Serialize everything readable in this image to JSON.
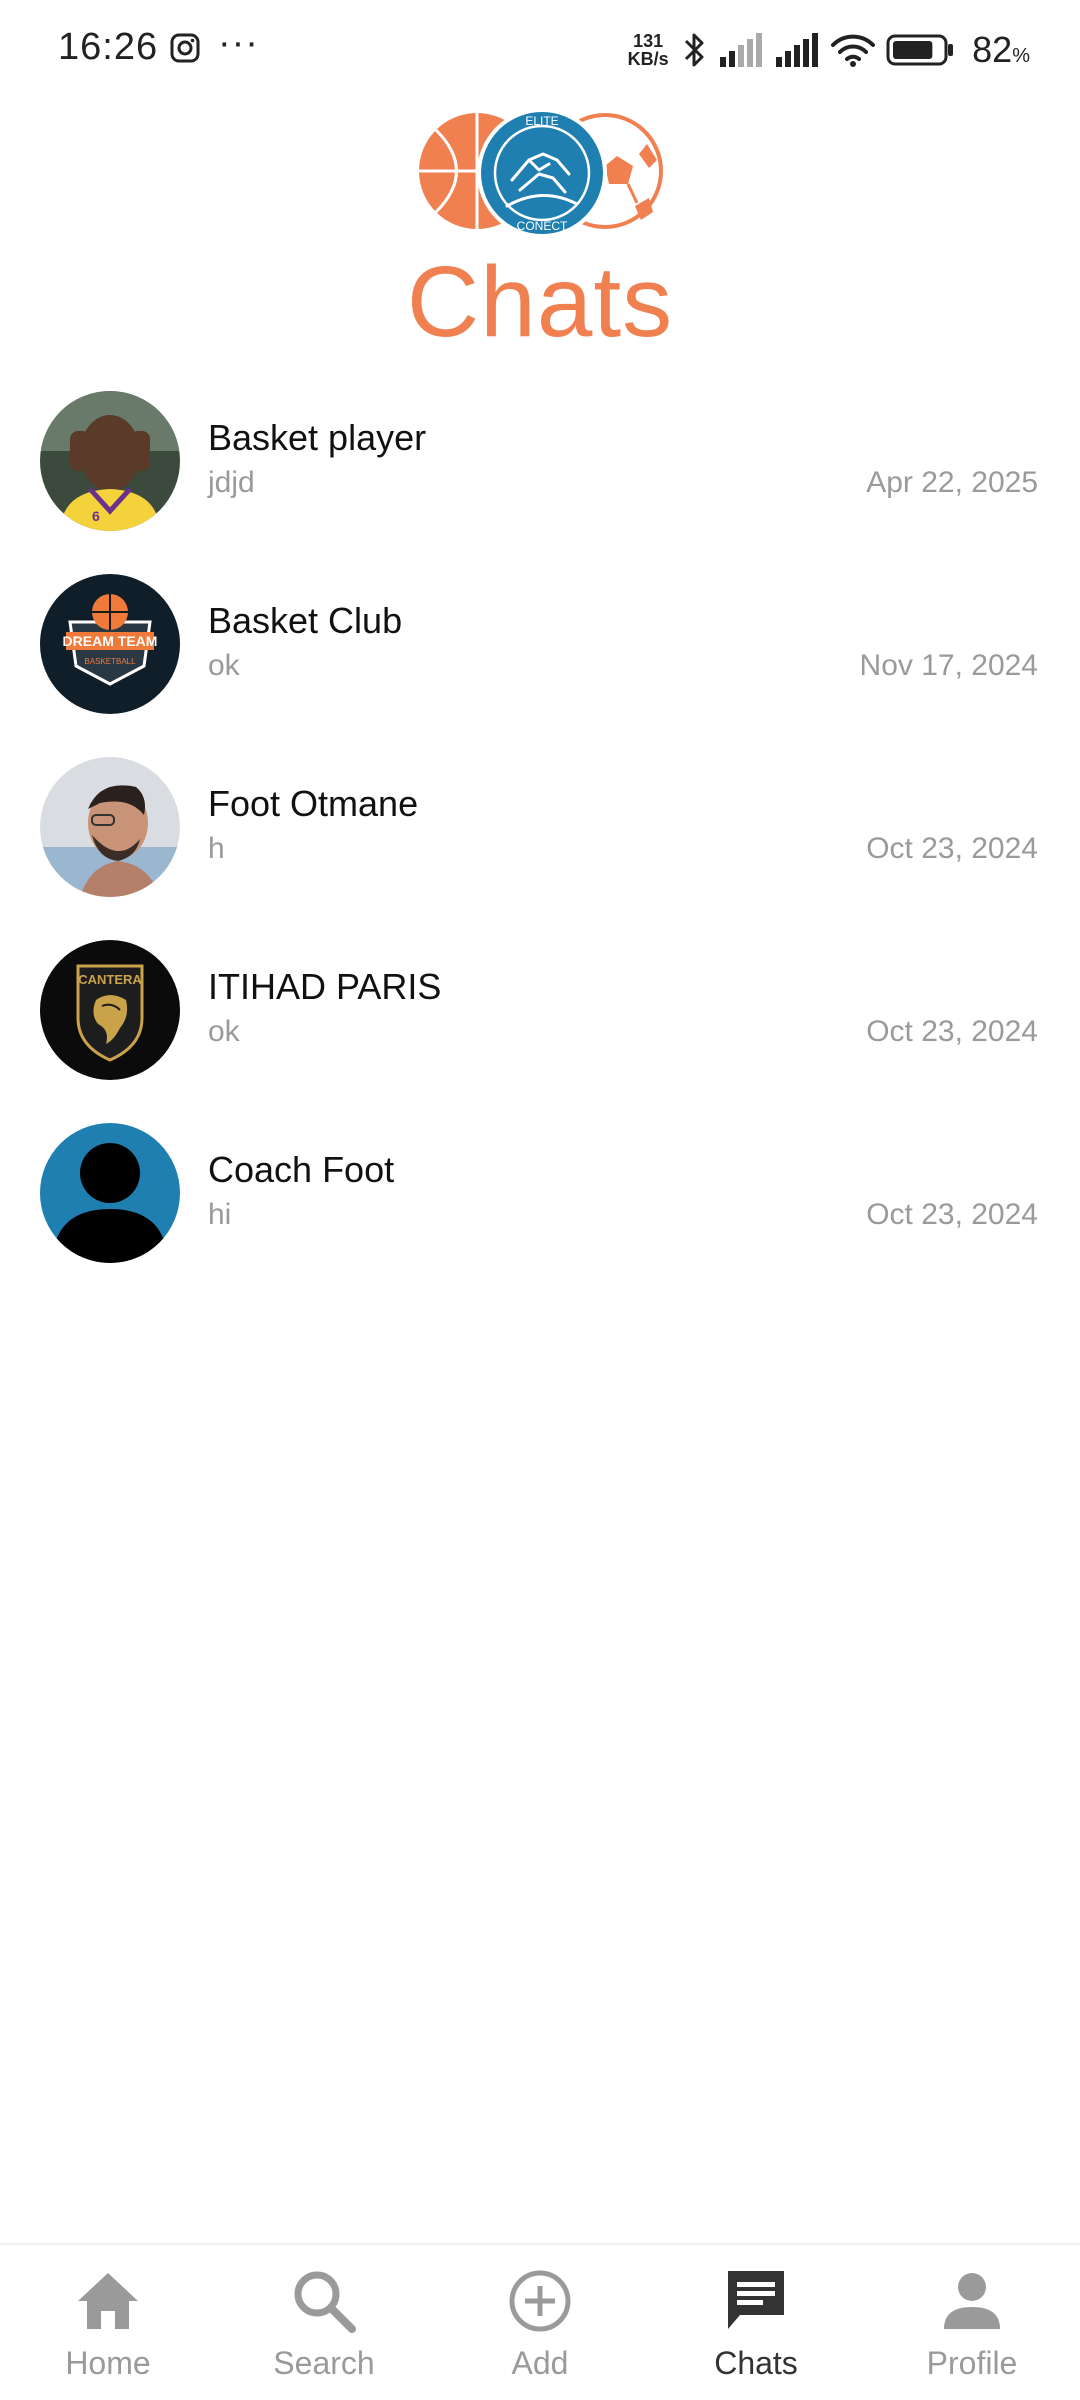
{
  "status_bar": {
    "time": "16:26",
    "more": "···",
    "net_speed_value": "131",
    "net_speed_unit": "KB/s",
    "battery_percent": "82",
    "battery_unit": "%",
    "battery_level": 0.82,
    "icons": [
      "instagram-icon",
      "bluetooth-icon",
      "signal-icon",
      "signal-icon",
      "wifi-icon",
      "battery-icon"
    ]
  },
  "header": {
    "logo_top_text": "ELITE",
    "logo_bottom_text": "CONECT",
    "title": "Chats",
    "accent_color": "#f08050",
    "logo_blue": "#1e7fb0"
  },
  "chats": [
    {
      "name": "Basket player",
      "last_message": "jdjd",
      "date": "Apr 22, 2025",
      "avatar": "player-photo"
    },
    {
      "name": "Basket Club",
      "last_message": "ok",
      "date": "Nov 17, 2024",
      "avatar": "dream-team-logo",
      "avatar_text_top": "DREAM TEAM",
      "avatar_text_bottom": "BASKETBALL"
    },
    {
      "name": "Foot Otmane",
      "last_message": "h",
      "date": "Oct 23, 2024",
      "avatar": "person-photo"
    },
    {
      "name": "ITIHAD PARIS",
      "last_message": "ok",
      "date": "Oct 23, 2024",
      "avatar": "cantera-logo",
      "avatar_text": "CANTERA"
    },
    {
      "name": "Coach Foot",
      "last_message": "hi",
      "date": "Oct 23, 2024",
      "avatar": "default-person"
    }
  ],
  "bottom_nav": {
    "items": [
      {
        "label": "Home",
        "icon": "home-icon",
        "active": false
      },
      {
        "label": "Search",
        "icon": "search-icon",
        "active": false
      },
      {
        "label": "Add",
        "icon": "add-circle-icon",
        "active": false
      },
      {
        "label": "Chats",
        "icon": "chat-icon",
        "active": true
      },
      {
        "label": "Profile",
        "icon": "profile-icon",
        "active": false
      }
    ]
  }
}
